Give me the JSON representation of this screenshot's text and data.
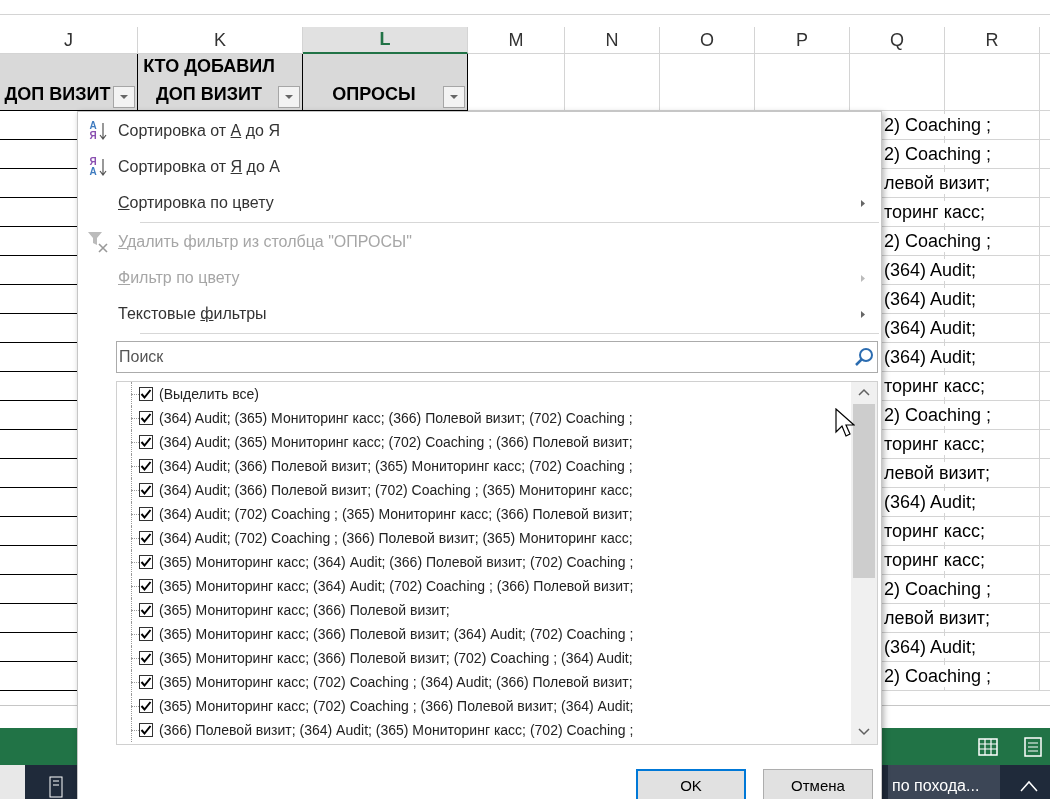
{
  "columns": [
    {
      "letter": "J",
      "selected": false
    },
    {
      "letter": "K",
      "selected": false
    },
    {
      "letter": "L",
      "selected": true
    },
    {
      "letter": "M",
      "selected": false
    },
    {
      "letter": "N",
      "selected": false
    },
    {
      "letter": "O",
      "selected": false
    },
    {
      "letter": "P",
      "selected": false
    },
    {
      "letter": "Q",
      "selected": false
    },
    {
      "letter": "R",
      "selected": false
    }
  ],
  "header_cells": [
    {
      "lines": [
        "ДОП ВИЗИТ"
      ],
      "filter": true
    },
    {
      "lines": [
        "КТО ДОБАВИЛ",
        "ДОП ВИЗИТ"
      ],
      "filter": true
    },
    {
      "lines": [
        "ОПРОСЫ"
      ],
      "filter": true
    }
  ],
  "rows": [
    "2) Coaching ;",
    "2) Coaching ;",
    "левой визит;",
    "торинг касс;",
    "2) Coaching ;",
    "(364) Audit;",
    "(364) Audit;",
    "(364) Audit;",
    "(364) Audit;",
    "торинг касс;",
    "2) Coaching ;",
    "торинг касс;",
    "левой визит;",
    "(364) Audit;",
    "торинг касс;",
    "торинг касс;",
    "2) Coaching ;",
    "левой визит;",
    "(364) Audit;",
    "2) Coaching ;"
  ],
  "filter_menu": {
    "items": [
      {
        "kind": "sort_asc",
        "icon_letters": [
          "А",
          "Я"
        ],
        "label": {
          "before": "Сортировка от ",
          "accel": "А",
          "after": " до Я"
        },
        "disabled": false,
        "submenu": false
      },
      {
        "kind": "sort_desc",
        "icon_letters": [
          "Я",
          "А"
        ],
        "label": {
          "before": "Сортировка от ",
          "accel": "Я",
          "after": " до А"
        },
        "disabled": false,
        "submenu": false
      },
      {
        "kind": "plain",
        "label": {
          "accel": "С",
          "after": "ортировка по цвету"
        },
        "disabled": false,
        "submenu": true
      },
      {
        "kind": "separator"
      },
      {
        "kind": "clear_filter",
        "label": {
          "accel": "У",
          "after": "далить фильтр из столбца \"ОПРОСЫ\""
        },
        "disabled": true,
        "submenu": false
      },
      {
        "kind": "plain",
        "label": {
          "accel": "Ф",
          "after": "ильтр по цвету"
        },
        "disabled": true,
        "submenu": true
      },
      {
        "kind": "plain",
        "label": {
          "before": "Текстовые ",
          "accel": "ф",
          "after": "ильтры"
        },
        "disabled": false,
        "submenu": true
      },
      {
        "kind": "separator"
      }
    ],
    "search": {
      "placeholder": "Поиск"
    },
    "values": [
      {
        "label": "(Выделить все)",
        "checked": true
      },
      {
        "label": "(364) Audit; (365) Мониторинг касс; (366) Полевой визит; (702) Coaching ;",
        "checked": true
      },
      {
        "label": "(364) Audit; (365) Мониторинг касс; (702) Coaching ; (366) Полевой визит;",
        "checked": true
      },
      {
        "label": "(364) Audit; (366) Полевой визит; (365) Мониторинг касс; (702) Coaching ;",
        "checked": true
      },
      {
        "label": "(364) Audit; (366) Полевой визит; (702) Coaching ; (365) Мониторинг касс;",
        "checked": true
      },
      {
        "label": "(364) Audit; (702) Coaching ; (365) Мониторинг касс; (366) Полевой визит;",
        "checked": true
      },
      {
        "label": "(364) Audit; (702) Coaching ; (366) Полевой визит; (365) Мониторинг касс;",
        "checked": true
      },
      {
        "label": "(365) Мониторинг касс; (364) Audit; (366) Полевой визит; (702) Coaching ;",
        "checked": true
      },
      {
        "label": "(365) Мониторинг касс; (364) Audit; (702) Coaching ; (366) Полевой визит;",
        "checked": true
      },
      {
        "label": "(365) Мониторинг касс; (366) Полевой визит;",
        "checked": true
      },
      {
        "label": "(365) Мониторинг касс; (366) Полевой визит; (364) Audit; (702) Coaching ;",
        "checked": true
      },
      {
        "label": "(365) Мониторинг касс; (366) Полевой визит; (702) Coaching ; (364) Audit;",
        "checked": true
      },
      {
        "label": "(365) Мониторинг касс; (702) Coaching ; (364) Audit; (366) Полевой визит;",
        "checked": true
      },
      {
        "label": "(365) Мониторинг касс; (702) Coaching ; (366) Полевой визит; (364) Audit;",
        "checked": true
      },
      {
        "label": "(366) Полевой визит; (364) Audit; (365) Мониторинг касс; (702) Coaching ;",
        "checked": true
      }
    ],
    "buttons": [
      {
        "label": "OK",
        "default": true
      },
      {
        "label": "Отмена",
        "default": false
      }
    ]
  },
  "taskbar": {
    "window_label": "по похода..."
  }
}
